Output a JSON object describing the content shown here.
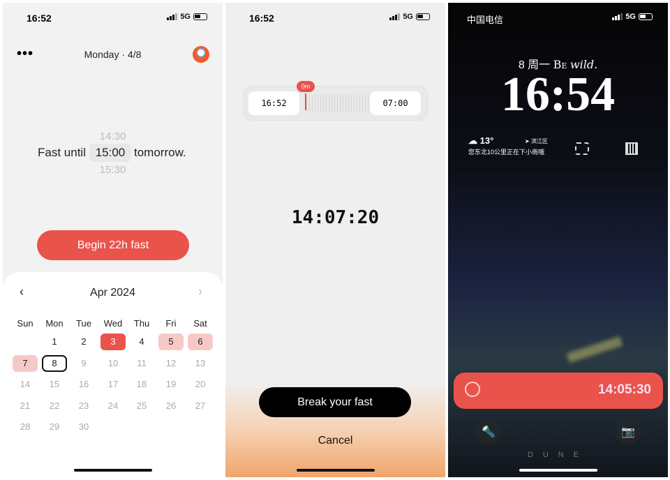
{
  "screen1": {
    "status_time": "16:52",
    "network": "5G",
    "menu_icon": "more-icon",
    "date_title": "Monday · 4/8",
    "picker": {
      "prefix": "Fast until",
      "above": "14:30",
      "selected": "15:00",
      "below": "15:30",
      "suffix": "tomorrow."
    },
    "begin_button": "Begin 22h fast",
    "calendar": {
      "month": "Apr 2024",
      "weekdays": [
        "Sun",
        "Mon",
        "Tue",
        "Wed",
        "Thu",
        "Fri",
        "Sat"
      ],
      "first_weekday": 1,
      "days_in_month": 30,
      "today": 8,
      "selected": 3,
      "highlighted": [
        5,
        6,
        7
      ],
      "past_days": [
        1,
        2,
        3,
        4,
        5,
        6,
        7,
        8
      ]
    }
  },
  "screen2": {
    "status_time": "16:52",
    "network": "5G",
    "start_time": "16:52",
    "end_time": "07:00",
    "elapsed_badge": "0m",
    "countdown": "14:07:20",
    "break_button": "Break your fast",
    "cancel_button": "Cancel"
  },
  "screen3": {
    "carrier": "中国电信",
    "network": "5G",
    "date_line": "8 周一",
    "tagline_a": "Be",
    "tagline_b": "wild.",
    "clock": "16:54",
    "weather_temp": "13°",
    "location": "滨江区",
    "weather_text": "您东北10公里正在下小雨哦",
    "live_activity_time": "14:05:30",
    "wallpaper_text": "DUNE"
  },
  "colors": {
    "accent": "#e9534c",
    "pink": "#f6c9c7"
  }
}
